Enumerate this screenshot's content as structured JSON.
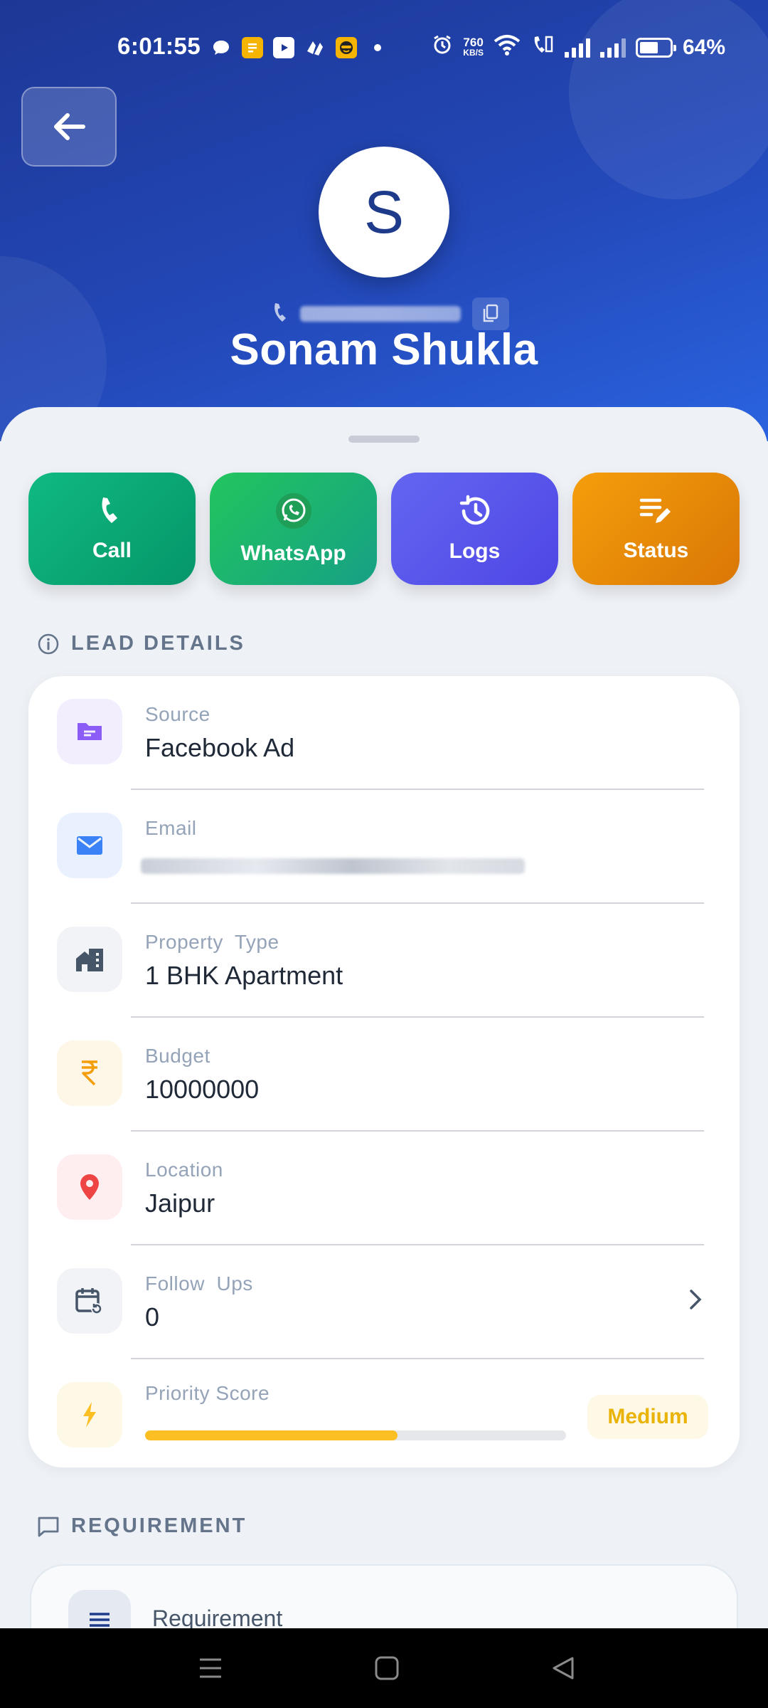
{
  "status_bar": {
    "time": "6:01:55",
    "net_speed_top": "760",
    "net_speed_bottom": "KB/S",
    "battery": "64%"
  },
  "lead": {
    "avatar_letter": "S",
    "name": "Sonam Shukla"
  },
  "actions": [
    {
      "label": "Call",
      "icon": "phone-icon"
    },
    {
      "label": "WhatsApp",
      "icon": "whatsapp-icon"
    },
    {
      "label": "Logs",
      "icon": "history-icon"
    },
    {
      "label": "Status",
      "icon": "edit-list-icon"
    }
  ],
  "lead_details": {
    "title": "LEAD DETAILS",
    "rows": [
      {
        "label": "Source",
        "value": "Facebook Ad",
        "icon": "folder-icon",
        "accent": "#8b5cf6"
      },
      {
        "label": "Email",
        "value": "",
        "icon": "mail-icon",
        "accent": "#3b82f6"
      },
      {
        "label": "Property  Type",
        "value": "1 BHK Apartment",
        "icon": "building-icon",
        "accent": "#475569"
      },
      {
        "label": "Budget",
        "value": "10000000",
        "icon": "rupee-icon",
        "accent": "#f59e0b"
      },
      {
        "label": "Location",
        "value": "Jaipur",
        "icon": "location-pin-icon",
        "accent": "#ef4444"
      },
      {
        "label": "Follow  Ups",
        "value": "0",
        "icon": "calendar-refresh-icon",
        "accent": "#475569"
      }
    ],
    "priority": {
      "label": "Priority Score",
      "level": "Medium",
      "score_fraction": 0.6,
      "accent": "#fbbf24"
    }
  },
  "requirement": {
    "title": "REQUIREMENT",
    "card_label": "Requirement"
  }
}
